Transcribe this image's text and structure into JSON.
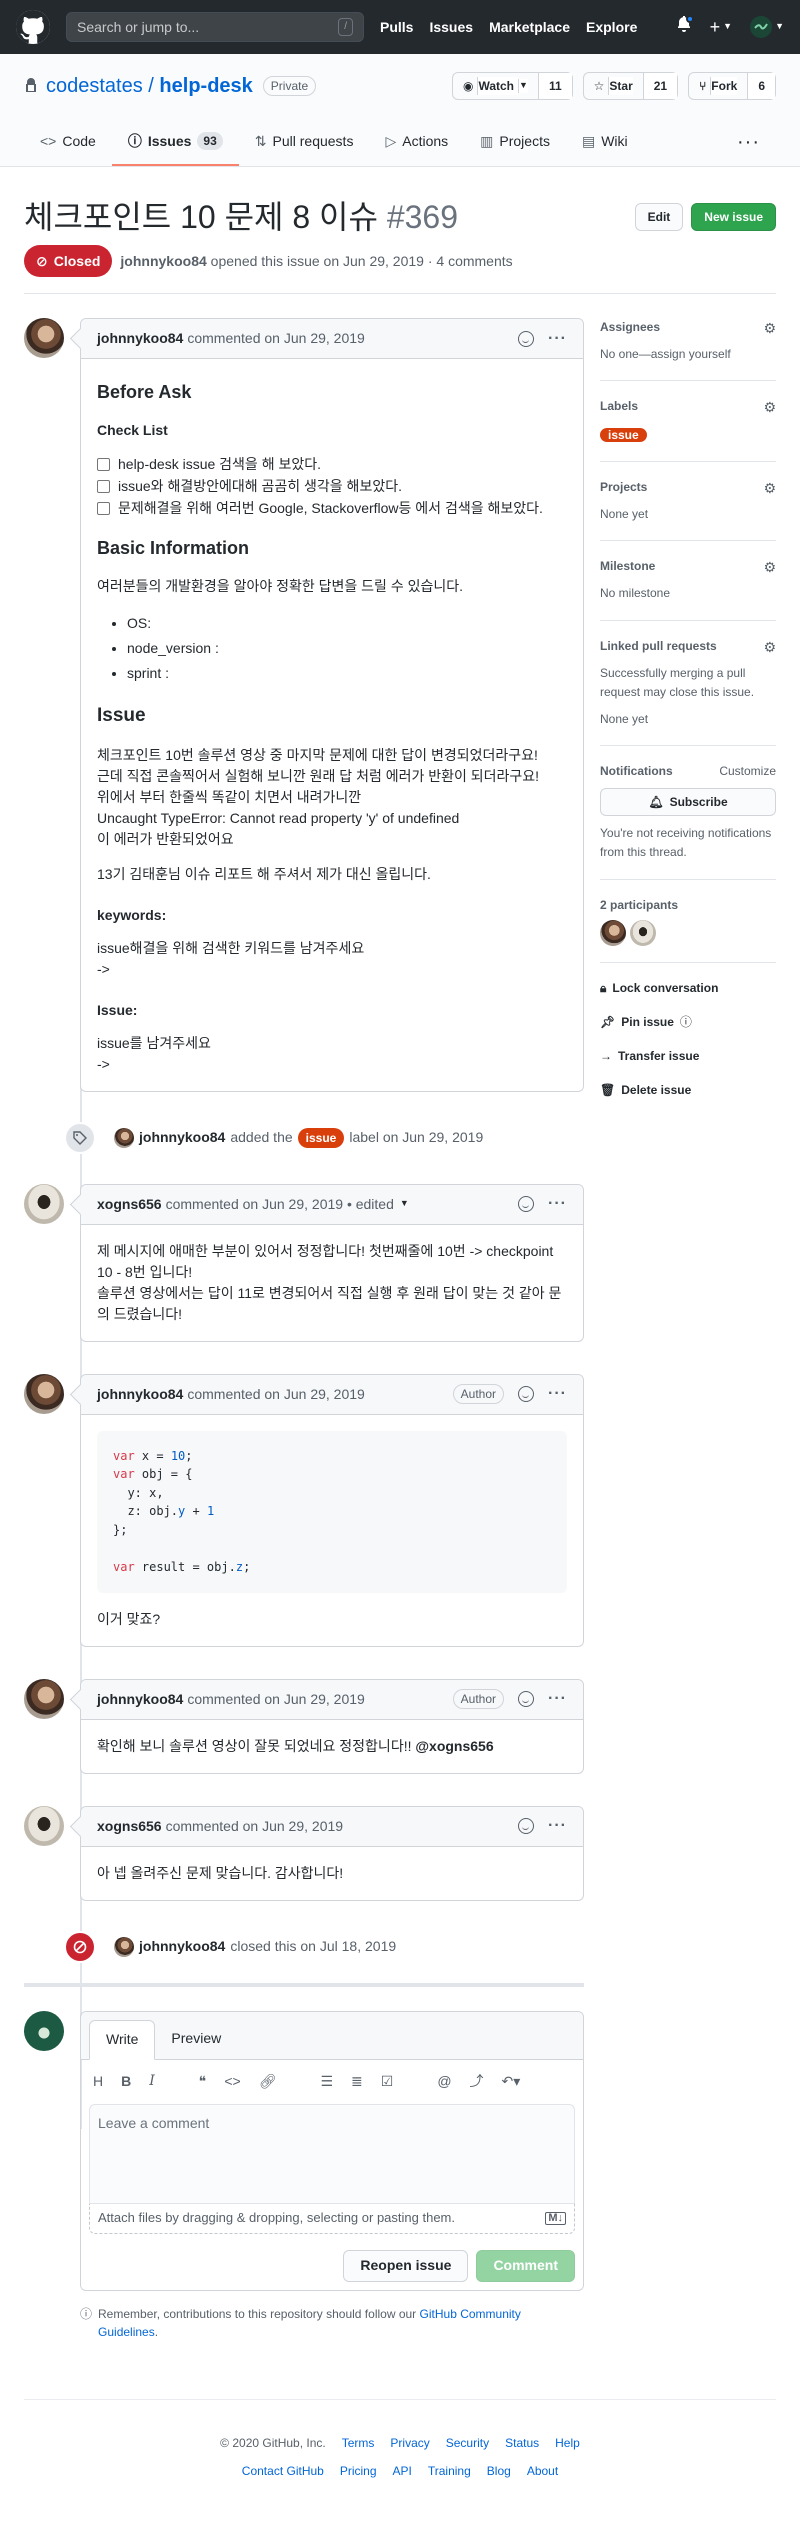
{
  "header": {
    "search_placeholder": "Search or jump to...",
    "slash": "/",
    "nav": [
      "Pulls",
      "Issues",
      "Marketplace",
      "Explore"
    ],
    "plus": "+"
  },
  "repo": {
    "owner": "codestates",
    "separator": "/",
    "name": "help-desk",
    "visibility": "Private",
    "watch_label": "Watch",
    "watch_count": "11",
    "star_label": "Star",
    "star_count": "21",
    "fork_label": "Fork",
    "fork_count": "6"
  },
  "tabs": [
    {
      "label": "Code",
      "icon": "code-icon"
    },
    {
      "label": "Issues",
      "icon": "issue-icon",
      "count": "93",
      "active": true
    },
    {
      "label": "Pull requests",
      "icon": "pr-icon"
    },
    {
      "label": "Actions",
      "icon": "play-icon"
    },
    {
      "label": "Projects",
      "icon": "project-icon"
    },
    {
      "label": "Wiki",
      "icon": "book-icon"
    }
  ],
  "issue": {
    "title": "체크포인트 10 문제 8 이슈",
    "number": "#369",
    "edit_label": "Edit",
    "new_issue_label": "New issue",
    "state": "Closed",
    "author": "johnnykoo84",
    "meta": "opened this issue on Jun 29, 2019 · 4 comments"
  },
  "first_comment": {
    "author": "johnnykoo84",
    "meta": "commented on Jun 29, 2019",
    "before_ask": "Before Ask",
    "check_list": "Check List",
    "checklist_items": [
      "help-desk issue 검색을 해 보았다.",
      "issue와 해결방안에대해 곰곰히 생각을 해보았다.",
      "문제해결을 위해 여러번 Google, Stackoverflow등 에서 검색을 해보았다."
    ],
    "basic_info": "Basic Information",
    "basic_info_text": "여러분들의 개발환경을 알아야 정확한 답변을 드릴 수 있습니다.",
    "env_items": [
      "OS:",
      "node_version :",
      "sprint :"
    ],
    "issue_heading": "Issue",
    "issue_lines": [
      "체크포인트 10번 솔루션 영상 중 마지막 문제에 대한 답이 변경되었더라구요!",
      "근데 직접 콘솔찍어서 실험해 보니깐 원래 답 처럼 에러가 반환이 되더라구요!",
      "위에서 부터 한줄씩 똑같이 치면서 내려가니깐",
      "Uncaught TypeError: Cannot read property 'y' of undefined",
      "이 에러가 반환되었어요"
    ],
    "report_text": "13기 김태훈님 이슈 리포트 해 주셔서 제가 대신 올립니다.",
    "keywords_heading": "keywords:",
    "keywords_text": "issue해결을 위해 검색한 키워드를 남겨주세요",
    "keywords_arrow": "->",
    "issue2_heading": "Issue:",
    "issue2_text": "issue를 남겨주세요",
    "issue2_arrow": "->"
  },
  "label_event": {
    "author": "johnnykoo84",
    "prefix": "added the",
    "label": "issue",
    "suffix": "label on Jun 29, 2019"
  },
  "comment2": {
    "author": "xogns656",
    "meta": "commented on Jun 29, 2019 • edited",
    "lines": [
      "제 메시지에 애매한 부분이 있어서 정정합니다! 첫번째줄에 10번 -> checkpoint 10 - 8번 입니다!",
      "솔루션 영상에서는 답이 11로 변경되어서 직접 실행 후 원래 답이 맞는 것 같아 문의 드렸습니다!"
    ]
  },
  "comment3": {
    "author": "johnnykoo84",
    "meta": "commented on Jun 29, 2019",
    "badge": "Author",
    "code_lines": [
      "var x = 10;",
      "var obj = {",
      "  y: x,",
      "  z: obj.y + 1",
      "};",
      "",
      "var result = obj.z;"
    ],
    "text": "이거 맞죠?"
  },
  "comment4": {
    "author": "johnnykoo84",
    "meta": "commented on Jun 29, 2019",
    "badge": "Author",
    "text": "확인해 보니 솔루션 영상이 잘못 되었네요 정정합니다!!",
    "mention": "@xogns656"
  },
  "comment5": {
    "author": "xogns656",
    "meta": "commented on Jun 29, 2019",
    "text": "아 넵 올려주신 문제 맞습니다. 감사합니다!"
  },
  "closed_event": {
    "author": "johnnykoo84",
    "text": "closed this on Jul 18, 2019"
  },
  "editor": {
    "write_tab": "Write",
    "preview_tab": "Preview",
    "placeholder": "Leave a comment",
    "attach_text": "Attach files by dragging & dropping, selecting or pasting them.",
    "reopen_label": "Reopen issue",
    "comment_label": "Comment"
  },
  "tip": {
    "text": "Remember, contributions to this repository should follow our",
    "link": "GitHub Community Guidelines",
    "end": "."
  },
  "sidebar": {
    "assignees_title": "Assignees",
    "assignees_value": "No one—assign yourself",
    "labels_title": "Labels",
    "label": "issue",
    "projects_title": "Projects",
    "projects_value": "None yet",
    "milestone_title": "Milestone",
    "milestone_value": "No milestone",
    "linked_title": "Linked pull requests",
    "linked_text": "Successfully merging a pull request may close this issue.",
    "linked_value": "None yet",
    "notifications_title": "Notifications",
    "customize": "Customize",
    "subscribe": "Subscribe",
    "notif_text": "You're not receiving notifications from this thread.",
    "participants_title": "2 participants",
    "lock": "Lock conversation",
    "pin": "Pin issue",
    "transfer": "Transfer issue",
    "delete": "Delete issue"
  },
  "footer": {
    "copyright": "© 2020 GitHub, Inc.",
    "row1": [
      "Terms",
      "Privacy",
      "Security",
      "Status",
      "Help"
    ],
    "row2": [
      "Contact GitHub",
      "Pricing",
      "API",
      "Training",
      "Blog",
      "About"
    ]
  },
  "colors": {
    "header_bg": "#24292e",
    "closed_red": "#cb2431",
    "label_orange": "#d93f0b",
    "link_blue": "#0366d6",
    "green": "#2ea44f"
  }
}
